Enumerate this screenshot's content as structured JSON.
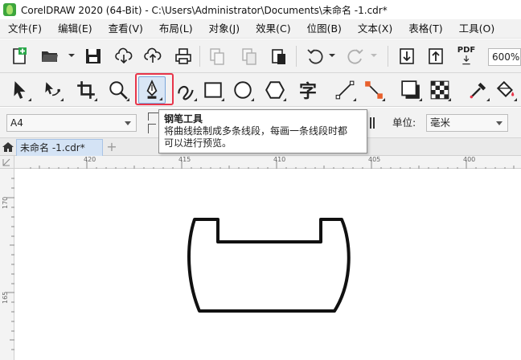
{
  "window": {
    "title": "CorelDRAW 2020 (64-Bit) - C:\\Users\\Administrator\\Documents\\未命名 -1.cdr*"
  },
  "menu": {
    "items": [
      {
        "label": "文件(F)"
      },
      {
        "label": "编辑(E)"
      },
      {
        "label": "查看(V)"
      },
      {
        "label": "布局(L)"
      },
      {
        "label": "对象(J)"
      },
      {
        "label": "效果(C)"
      },
      {
        "label": "位图(B)"
      },
      {
        "label": "文本(X)"
      },
      {
        "label": "表格(T)"
      },
      {
        "label": "工具(O)"
      }
    ]
  },
  "toolbar": {
    "zoom": "600%",
    "icons": [
      "new-document-icon",
      "open-folder-icon",
      "save-icon",
      "cloud-download-icon",
      "cloud-upload-icon",
      "print-icon",
      "copy-icon",
      "paste-icon",
      "clipboard-icon",
      "undo-icon",
      "redo-icon",
      "import-icon",
      "export-icon",
      "pdf-icon"
    ],
    "pdf_label": "PDF"
  },
  "toolbox": {
    "tools": [
      "pick-tool",
      "shape-tool",
      "crop-tool",
      "zoom-tool",
      "pen-tool",
      "artistic-media-tool",
      "rectangle-tool",
      "ellipse-tool",
      "polygon-tool",
      "text-tool",
      "line-tool",
      "connector-tool",
      "drop-shadow-tool",
      "transparency-tool",
      "eyedropper-tool",
      "fill-tool"
    ],
    "text_tool_glyph": "字",
    "active_tool": "pen-tool",
    "highlight_color": "#e8354a"
  },
  "property_bar": {
    "page_size": "A4",
    "units_label": "单位:",
    "units_value": "毫米"
  },
  "tooltip": {
    "title": "钢笔工具",
    "body_line1": "将曲线绘制成多条线段，每画一条线段时都",
    "body_line2": "可以进行预览。"
  },
  "document_tabs": {
    "active_tab": "未命名 -1.cdr*",
    "add_tab": "+"
  },
  "rulers": {
    "horizontal_labels": [
      "420",
      "415",
      "410",
      "405",
      "400"
    ],
    "vertical_labels": [
      "170",
      "165"
    ]
  },
  "colors": {
    "accent": "#e8354a",
    "tab_active": "#d4e3f5",
    "shape_stroke": "#111111"
  }
}
